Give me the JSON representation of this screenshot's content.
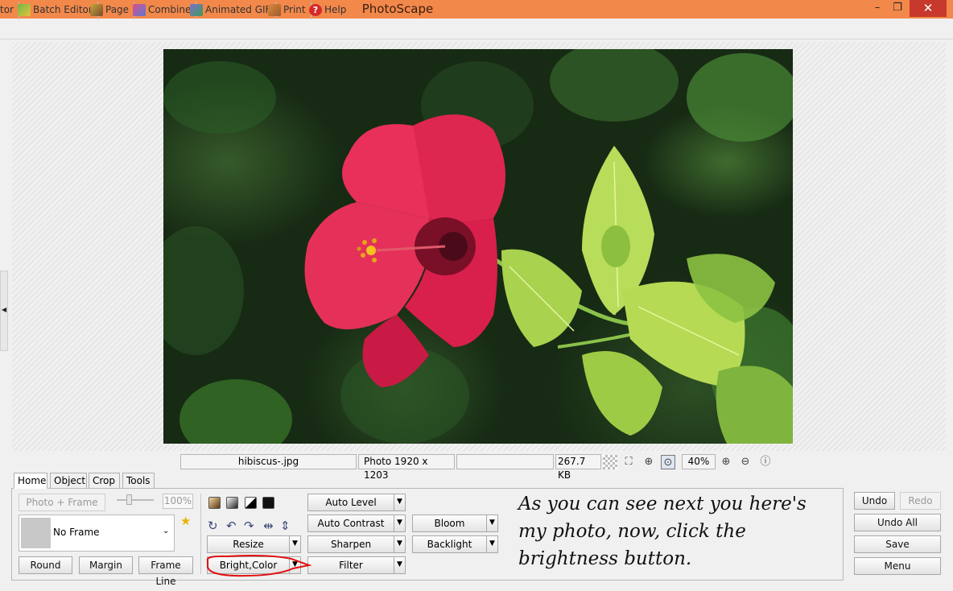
{
  "window": {
    "title": "PhotoScape",
    "minimize": "–",
    "maximize": "❐",
    "close": "✕"
  },
  "menu_tabs": [
    {
      "label": "tor",
      "icon": "editor-icon"
    },
    {
      "label": "Batch Editor",
      "icon": "batch-editor-icon"
    },
    {
      "label": "Page",
      "icon": "page-icon"
    },
    {
      "label": "Combine",
      "icon": "combine-icon"
    },
    {
      "label": "Animated GIF",
      "icon": "animated-gif-icon"
    },
    {
      "label": "Print",
      "icon": "print-icon"
    },
    {
      "label": "Help",
      "icon": "help-icon"
    }
  ],
  "status": {
    "filename": "hibiscus-.jpg",
    "photo_info": "Photo 1920 x 1203",
    "empty": "",
    "file_size": "267.7 KB",
    "zoom": "40%"
  },
  "panel_tabs": [
    "Home",
    "Object",
    "Crop",
    "Tools"
  ],
  "home": {
    "photo_frame": "Photo + Frame",
    "frame_percent": "100%",
    "frame_select": "No Frame",
    "round": "Round",
    "margin": "Margin",
    "frame_line": "Frame Line"
  },
  "tools": {
    "auto_level": "Auto Level",
    "auto_contrast": "Auto Contrast",
    "sharpen": "Sharpen",
    "filter": "Filter",
    "resize": "Resize",
    "bright_color": "Bright,Color",
    "bloom": "Bloom",
    "backlight": "Backlight"
  },
  "actions": {
    "undo": "Undo",
    "redo": "Redo",
    "undo_all": "Undo All",
    "save": "Save",
    "menu": "Menu"
  },
  "annotation": {
    "line1": "As you can see next you here's",
    "line2": "my photo, now, click the",
    "line3": "brightness button."
  },
  "colors": {
    "titlebar": "#f2884a",
    "close": "#c7392c",
    "annotation_circle": "#e01010"
  }
}
